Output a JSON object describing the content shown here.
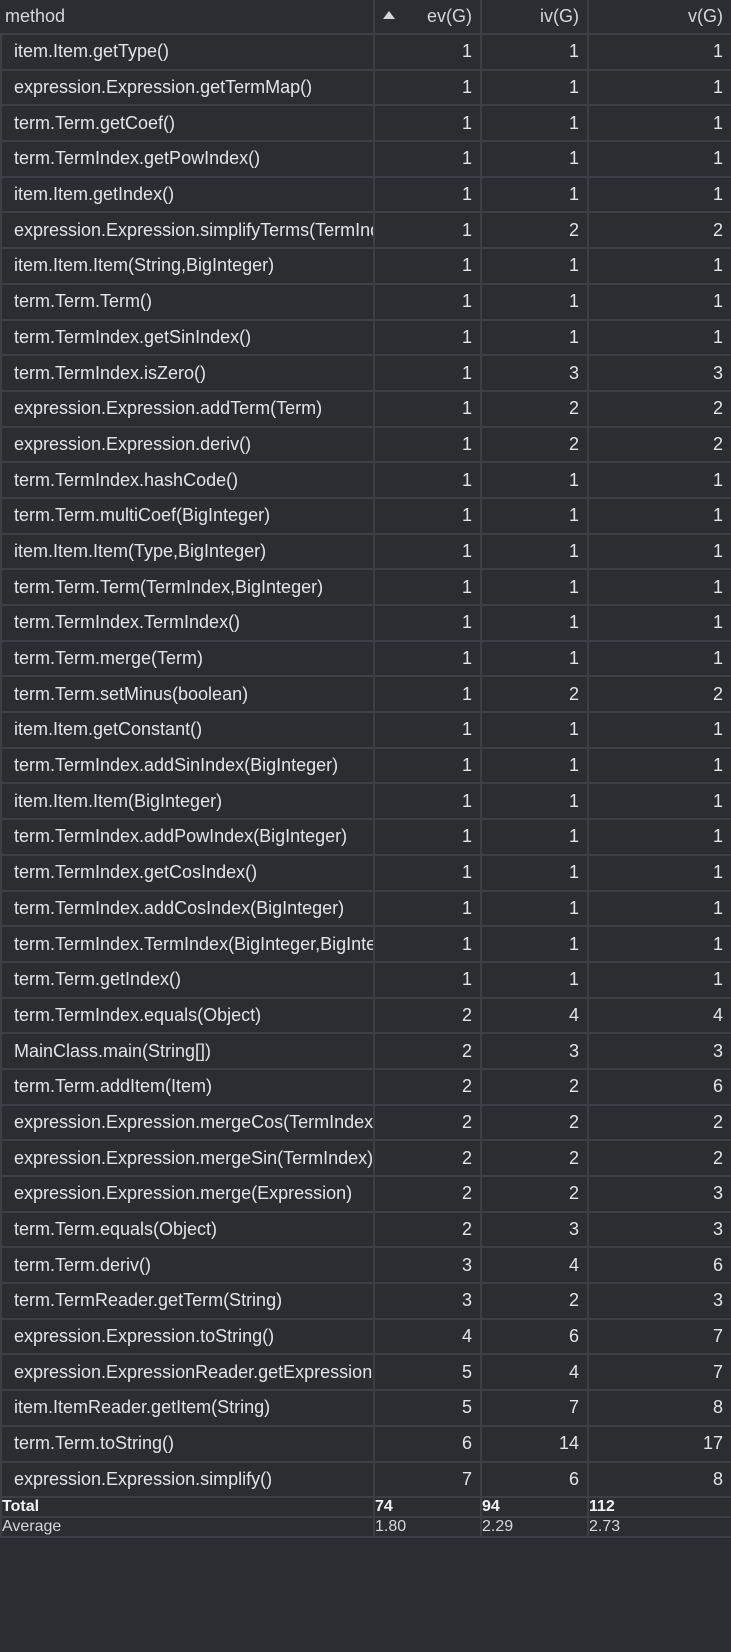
{
  "header": {
    "method": "method",
    "ev": "ev(G)",
    "iv": "iv(G)",
    "v": "v(G)",
    "sort_icon": "sort-ascending-icon"
  },
  "rows": [
    {
      "method": "item.Item.getType()",
      "ev": "1",
      "iv": "1",
      "v": "1"
    },
    {
      "method": "expression.Expression.getTermMap()",
      "ev": "1",
      "iv": "1",
      "v": "1"
    },
    {
      "method": "term.Term.getCoef()",
      "ev": "1",
      "iv": "1",
      "v": "1"
    },
    {
      "method": "term.TermIndex.getPowIndex()",
      "ev": "1",
      "iv": "1",
      "v": "1"
    },
    {
      "method": "item.Item.getIndex()",
      "ev": "1",
      "iv": "1",
      "v": "1"
    },
    {
      "method": "expression.Expression.simplifyTerms(TermIndex)",
      "ev": "1",
      "iv": "2",
      "v": "2"
    },
    {
      "method": "item.Item.Item(String,BigInteger)",
      "ev": "1",
      "iv": "1",
      "v": "1"
    },
    {
      "method": "term.Term.Term()",
      "ev": "1",
      "iv": "1",
      "v": "1"
    },
    {
      "method": "term.TermIndex.getSinIndex()",
      "ev": "1",
      "iv": "1",
      "v": "1"
    },
    {
      "method": "term.TermIndex.isZero()",
      "ev": "1",
      "iv": "3",
      "v": "3"
    },
    {
      "method": "expression.Expression.addTerm(Term)",
      "ev": "1",
      "iv": "2",
      "v": "2"
    },
    {
      "method": "expression.Expression.deriv()",
      "ev": "1",
      "iv": "2",
      "v": "2"
    },
    {
      "method": "term.TermIndex.hashCode()",
      "ev": "1",
      "iv": "1",
      "v": "1"
    },
    {
      "method": "term.Term.multiCoef(BigInteger)",
      "ev": "1",
      "iv": "1",
      "v": "1"
    },
    {
      "method": "item.Item.Item(Type,BigInteger)",
      "ev": "1",
      "iv": "1",
      "v": "1"
    },
    {
      "method": "term.Term.Term(TermIndex,BigInteger)",
      "ev": "1",
      "iv": "1",
      "v": "1"
    },
    {
      "method": "term.TermIndex.TermIndex()",
      "ev": "1",
      "iv": "1",
      "v": "1"
    },
    {
      "method": "term.Term.merge(Term)",
      "ev": "1",
      "iv": "1",
      "v": "1"
    },
    {
      "method": "term.Term.setMinus(boolean)",
      "ev": "1",
      "iv": "2",
      "v": "2"
    },
    {
      "method": "item.Item.getConstant()",
      "ev": "1",
      "iv": "1",
      "v": "1"
    },
    {
      "method": "term.TermIndex.addSinIndex(BigInteger)",
      "ev": "1",
      "iv": "1",
      "v": "1"
    },
    {
      "method": "item.Item.Item(BigInteger)",
      "ev": "1",
      "iv": "1",
      "v": "1"
    },
    {
      "method": "term.TermIndex.addPowIndex(BigInteger)",
      "ev": "1",
      "iv": "1",
      "v": "1"
    },
    {
      "method": "term.TermIndex.getCosIndex()",
      "ev": "1",
      "iv": "1",
      "v": "1"
    },
    {
      "method": "term.TermIndex.addCosIndex(BigInteger)",
      "ev": "1",
      "iv": "1",
      "v": "1"
    },
    {
      "method": "term.TermIndex.TermIndex(BigInteger,BigInteger,BigInteger)",
      "ev": "1",
      "iv": "1",
      "v": "1"
    },
    {
      "method": "term.Term.getIndex()",
      "ev": "1",
      "iv": "1",
      "v": "1"
    },
    {
      "method": "term.TermIndex.equals(Object)",
      "ev": "2",
      "iv": "4",
      "v": "4"
    },
    {
      "method": "MainClass.main(String[])",
      "ev": "2",
      "iv": "3",
      "v": "3"
    },
    {
      "method": "term.Term.addItem(Item)",
      "ev": "2",
      "iv": "2",
      "v": "6"
    },
    {
      "method": "expression.Expression.mergeCos(TermIndex)",
      "ev": "2",
      "iv": "2",
      "v": "2"
    },
    {
      "method": "expression.Expression.mergeSin(TermIndex)",
      "ev": "2",
      "iv": "2",
      "v": "2"
    },
    {
      "method": "expression.Expression.merge(Expression)",
      "ev": "2",
      "iv": "2",
      "v": "3"
    },
    {
      "method": "term.Term.equals(Object)",
      "ev": "2",
      "iv": "3",
      "v": "3"
    },
    {
      "method": "term.Term.deriv()",
      "ev": "3",
      "iv": "4",
      "v": "6"
    },
    {
      "method": "term.TermReader.getTerm(String)",
      "ev": "3",
      "iv": "2",
      "v": "3"
    },
    {
      "method": "expression.Expression.toString()",
      "ev": "4",
      "iv": "6",
      "v": "7"
    },
    {
      "method": "expression.ExpressionReader.getExpression(String)",
      "ev": "5",
      "iv": "4",
      "v": "7"
    },
    {
      "method": "item.ItemReader.getItem(String)",
      "ev": "5",
      "iv": "7",
      "v": "8"
    },
    {
      "method": "term.Term.toString()",
      "ev": "6",
      "iv": "14",
      "v": "17"
    },
    {
      "method": "expression.Expression.simplify()",
      "ev": "7",
      "iv": "6",
      "v": "8"
    }
  ],
  "total": {
    "label": "Total",
    "ev": "74",
    "iv": "94",
    "v": "112"
  },
  "average": {
    "label": "Average",
    "ev": "1.80",
    "iv": "2.29",
    "v": "2.73"
  }
}
